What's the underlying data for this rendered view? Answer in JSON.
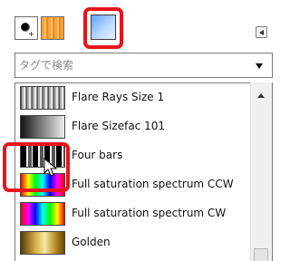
{
  "tabs": [
    {
      "icon": "brush-tab-icon"
    },
    {
      "icon": "pattern-tab-icon"
    },
    {
      "icon": "gradient-tab-icon",
      "selected": true
    }
  ],
  "tag_filter": {
    "placeholder": "タグで検索",
    "icon": "dropdown-arrow-icon"
  },
  "gradients": [
    {
      "name": "Flare Rays Size 1"
    },
    {
      "name": "Flare Sizefac 101"
    },
    {
      "name": "Four bars"
    },
    {
      "name": "Full saturation spectrum CCW",
      "highlighted": true
    },
    {
      "name": "Full saturation spectrum CW"
    },
    {
      "name": "Golden"
    }
  ],
  "highlight_color": "#e8141b"
}
